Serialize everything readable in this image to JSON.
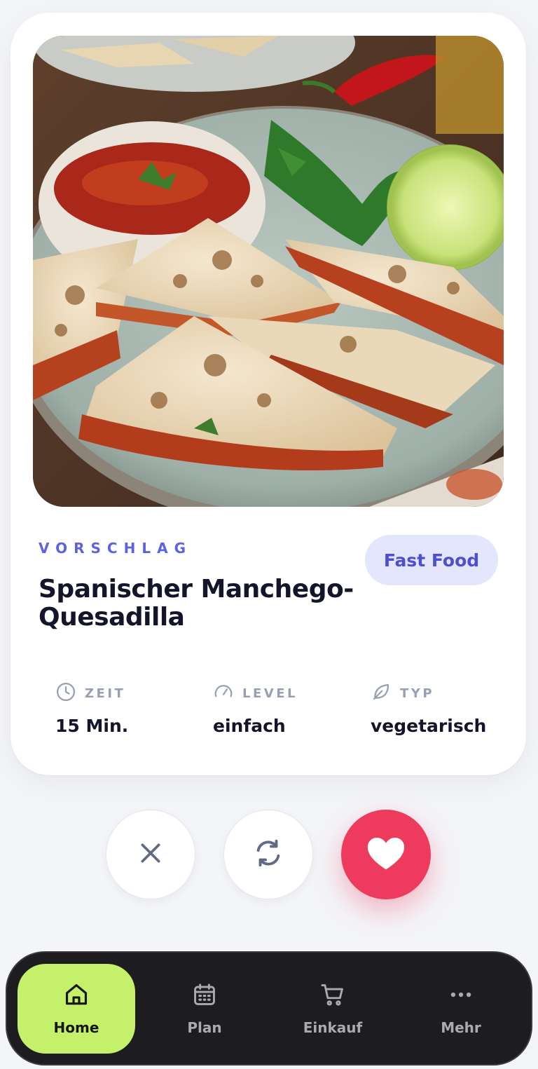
{
  "colors": {
    "accent": "#5b63e3",
    "badge_bg": "#e3e6fc",
    "like": "#ee3a5d",
    "nav_active": "#c5f06a",
    "nav_bg": "#1d1d1f"
  },
  "recipe": {
    "eyebrow": "VORSCHLAG",
    "title": "Spanischer Manchego-Quesadilla",
    "category": "Fast Food",
    "image_icon": "quesadilla-photo"
  },
  "stats": [
    {
      "icon": "clock-icon",
      "label": "ZEIT",
      "value": "15 Min."
    },
    {
      "icon": "gauge-icon",
      "label": "LEVEL",
      "value": "einfach"
    },
    {
      "icon": "leaf-icon",
      "label": "TYP",
      "value": "vegetarisch"
    }
  ],
  "actions": [
    {
      "icon": "close-icon",
      "name": "dismiss"
    },
    {
      "icon": "refresh-icon",
      "name": "shuffle"
    },
    {
      "icon": "heart-icon",
      "name": "like"
    }
  ],
  "nav": {
    "items": [
      {
        "label": "Home",
        "icon": "home-icon",
        "active": true
      },
      {
        "label": "Plan",
        "icon": "calendar-icon",
        "active": false
      },
      {
        "label": "Einkauf",
        "icon": "cart-icon",
        "active": false
      },
      {
        "label": "Mehr",
        "icon": "more-icon",
        "active": false
      }
    ]
  }
}
